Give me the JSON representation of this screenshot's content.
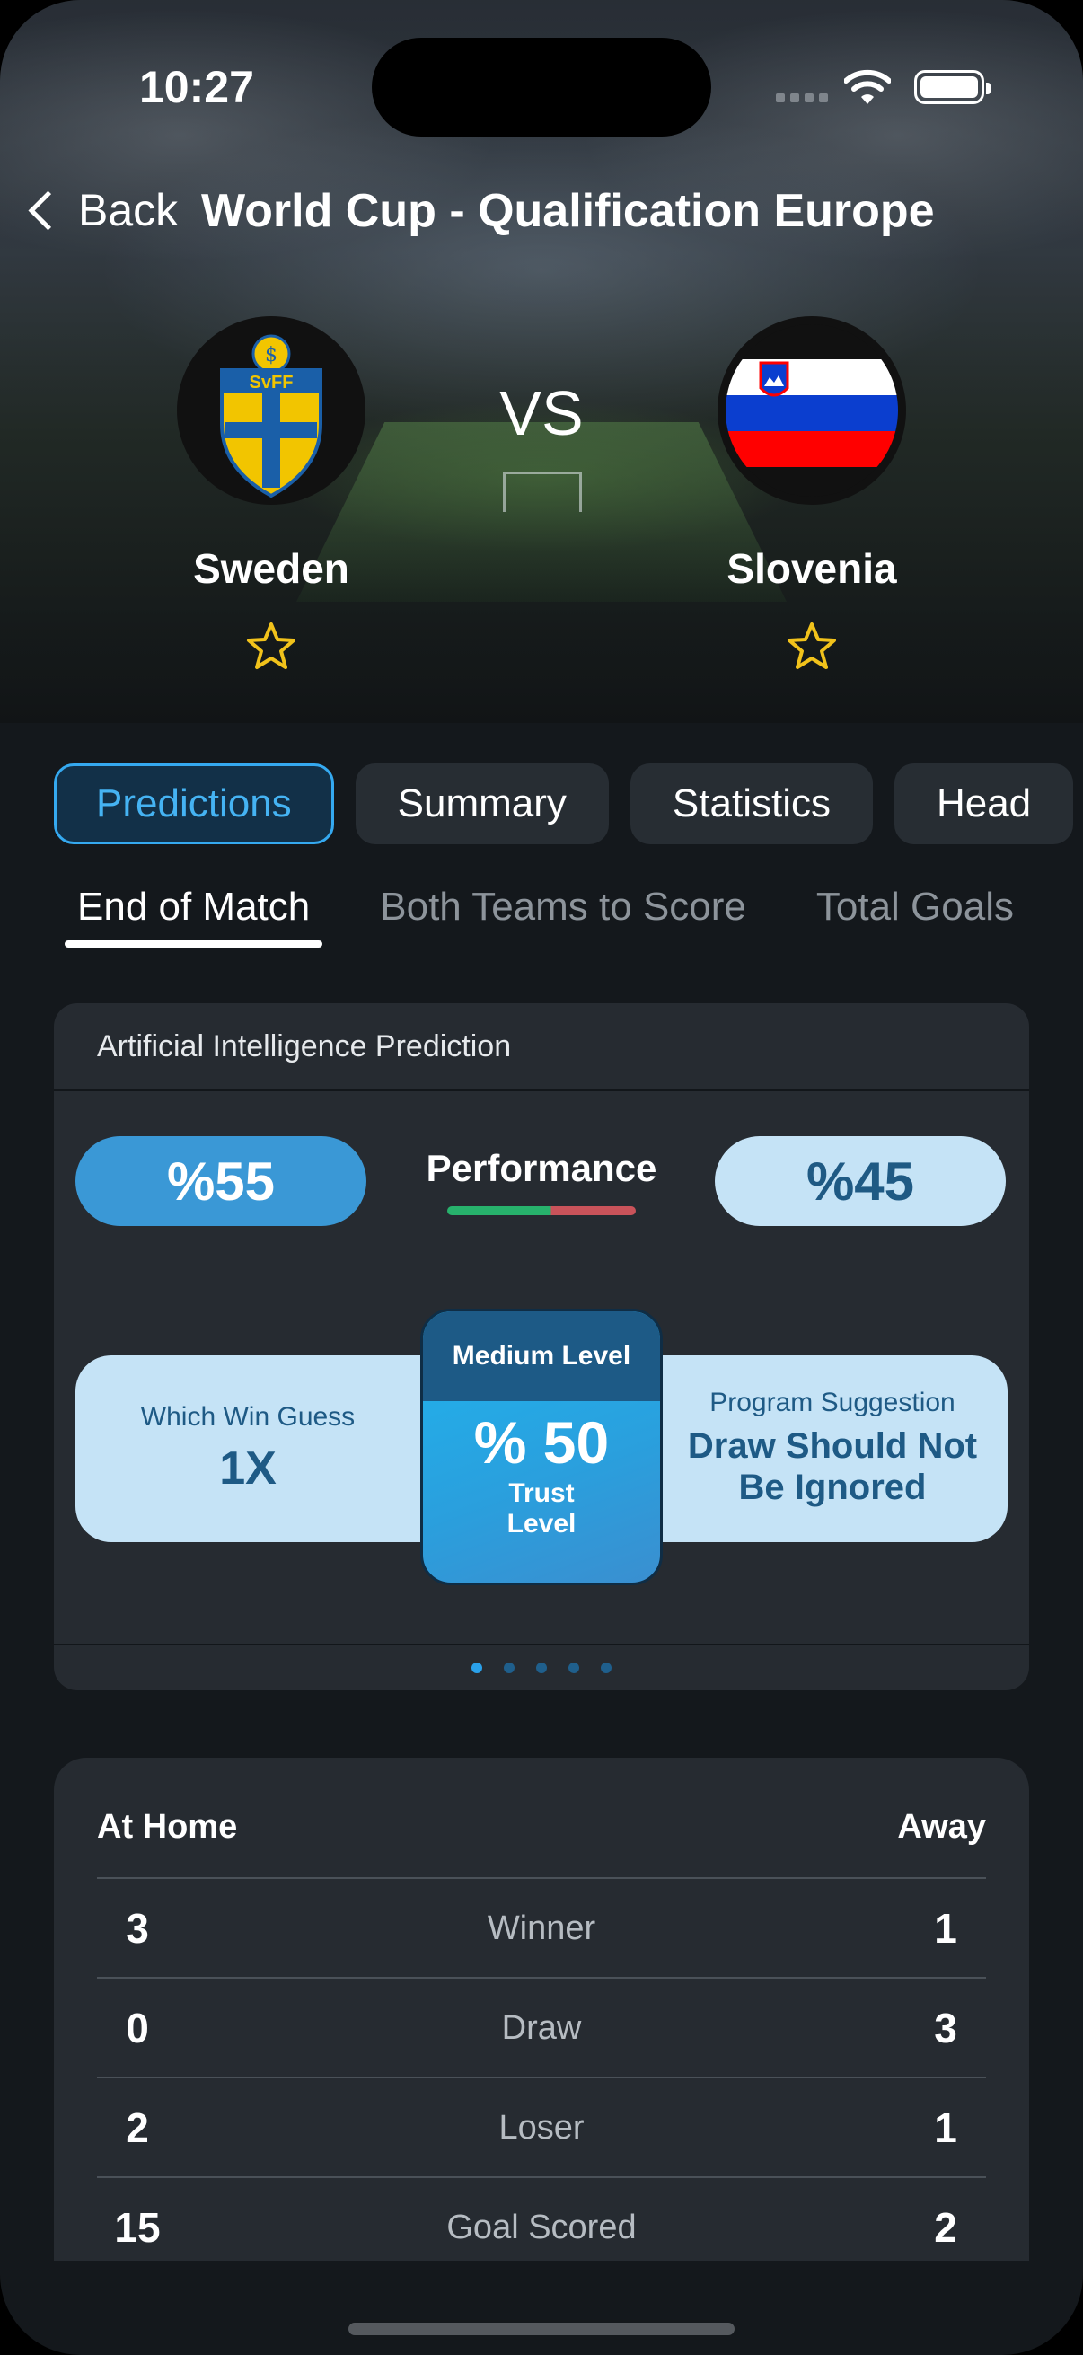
{
  "status_bar": {
    "time": "10:27"
  },
  "nav": {
    "back_label": "Back",
    "title": "World Cup - Qualification Europe"
  },
  "match": {
    "vs_label": "VS",
    "home": {
      "name": "Sweden",
      "crest_text": "SvFF"
    },
    "away": {
      "name": "Slovenia"
    }
  },
  "tabs": [
    "Predictions",
    "Summary",
    "Statistics",
    "Head"
  ],
  "active_tab": "Predictions",
  "subtabs": [
    "End of Match",
    "Both Teams to Score",
    "Total Goals"
  ],
  "active_subtab": "End of Match",
  "ai_card": {
    "title": "Artificial Intelligence Prediction",
    "home_percent": "%55",
    "away_percent": "%45",
    "performance_label": "Performance",
    "performance_split": 0.55,
    "which_win_label": "Which Win Guess",
    "which_win_value": "1X",
    "trust": {
      "header": "Medium Level",
      "value": "% 50",
      "label_line1": "Trust",
      "label_line2": "Level"
    },
    "suggestion_label": "Program Suggestion",
    "suggestion_line1": "Draw Should Not",
    "suggestion_line2": "Be Ignored",
    "pager_count": 5,
    "pager_active": 0
  },
  "stats_table": {
    "home_header": "At Home",
    "away_header": "Away",
    "rows": [
      {
        "home": "3",
        "label": "Winner",
        "away": "1"
      },
      {
        "home": "0",
        "label": "Draw",
        "away": "3"
      },
      {
        "home": "2",
        "label": "Loser",
        "away": "1"
      },
      {
        "home": "15",
        "label": "Goal Scored",
        "away": "2"
      }
    ]
  },
  "colors": {
    "accent": "#35a9f0",
    "home_pill": "#3a98d6",
    "away_pill": "#c5e3f6",
    "star": "#f1c21b",
    "card_bg": "#262b31"
  }
}
